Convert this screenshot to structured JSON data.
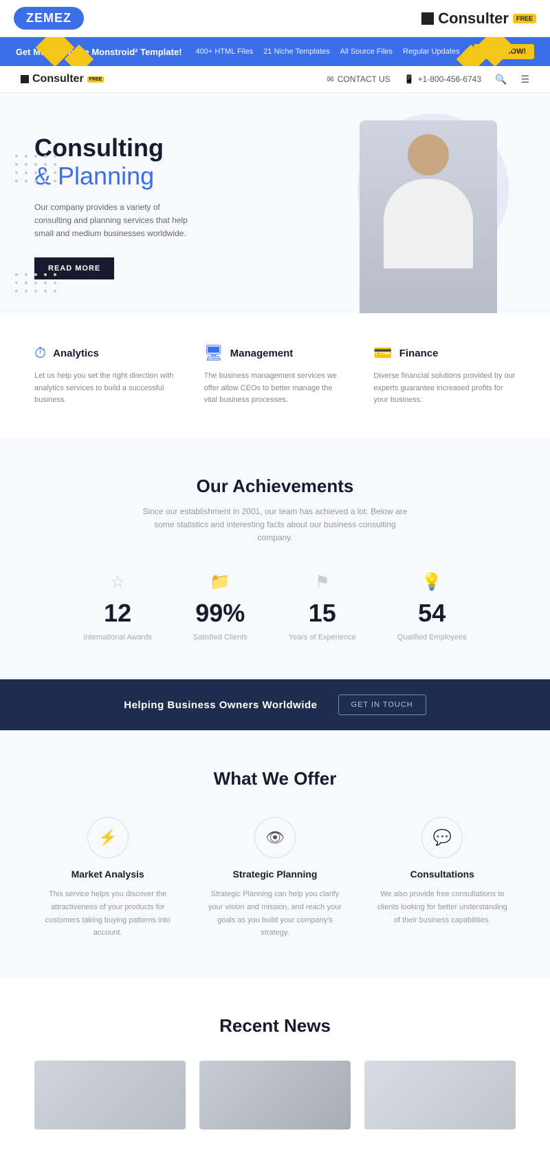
{
  "topbar": {
    "zemez_label": "ZEMEZ",
    "consulter_label": "Consulter",
    "free_badge": "FREE"
  },
  "promo": {
    "text": "Get Multipurpose Monstroid² Template!",
    "stat1": "400+ HTML Files",
    "stat2": "21 Niche Templates",
    "stat3": "All Source Files",
    "stat4": "Regular Updates",
    "shop_btn": "SHOP NOW!"
  },
  "nav": {
    "logo": "Consulter",
    "free": "FREE",
    "contact_label": "CONTACT US",
    "phone": "+1-800-456-6743"
  },
  "hero": {
    "title_line1": "Consulting",
    "title_line2": "& Planning",
    "description": "Our company provides a variety of consulting and planning services that help small and medium businesses worldwide.",
    "read_more_btn": "READ MORE"
  },
  "services": [
    {
      "icon": "⏱",
      "title": "Analytics",
      "description": "Let us help you set the right direction with analytics services to build a successful business."
    },
    {
      "icon": "🖥",
      "title": "Management",
      "description": "The business management services we offer allow CEOs to better manage the vital business processes."
    },
    {
      "icon": "💳",
      "title": "Finance",
      "description": "Diverse financial solutions provided by our experts guarantee increased profits for your business."
    }
  ],
  "achievements": {
    "title": "Our Achievements",
    "subtitle": "Since our establishment in 2001, our team has achieved a lot. Below are some statistics and interesting facts about our business consulting company.",
    "stats": [
      {
        "icon": "☆",
        "number": "12",
        "label": "International Awards"
      },
      {
        "icon": "📁",
        "number": "99%",
        "label": "Satisfied Clients"
      },
      {
        "icon": "⚑",
        "number": "15",
        "label": "Years of Experience"
      },
      {
        "icon": "💡",
        "number": "54",
        "label": "Qualified Employees"
      }
    ]
  },
  "cta": {
    "text": "Helping Business Owners Worldwide",
    "btn": "GET IN TOUCH"
  },
  "offers": {
    "title": "What We Offer",
    "items": [
      {
        "icon": "⚡",
        "title": "Market Analysis",
        "description": "This service helps you discover the attractiveness of your products for customers taking buying patterns into account."
      },
      {
        "icon": "👁",
        "title": "Strategic Planning",
        "description": "Strategic Planning can help you clarify your vision and mission, and reach your goals as you build your company's strategy."
      },
      {
        "icon": "💬",
        "title": "Consultations",
        "description": "We also provide free consultations to clients looking for better understanding of their business capabilities."
      }
    ]
  },
  "news": {
    "title": "Recent News"
  }
}
